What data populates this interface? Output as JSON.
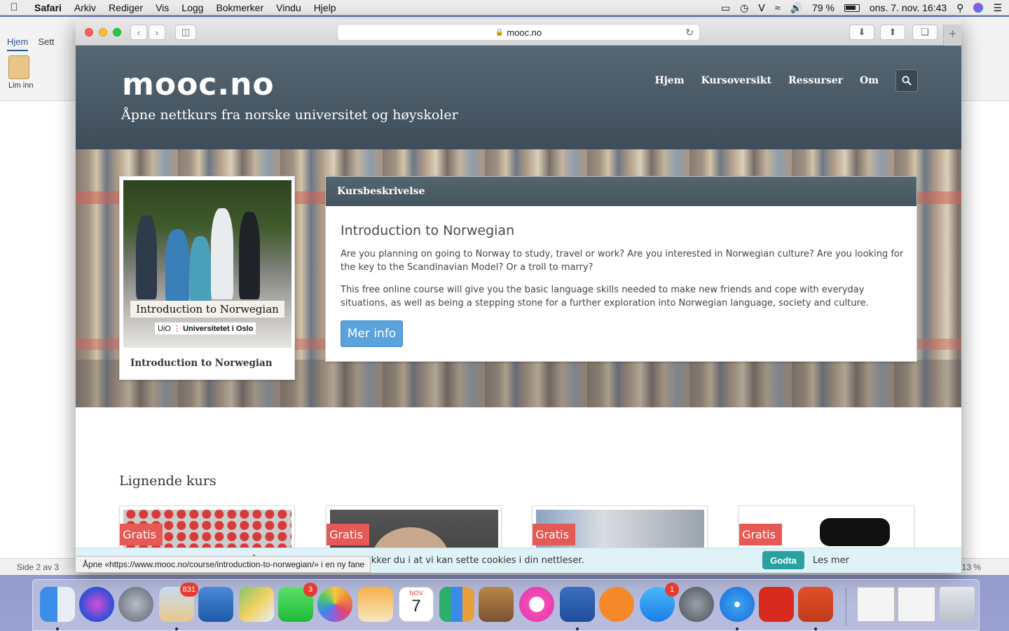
{
  "menubar": {
    "app": "Safari",
    "items": [
      "Arkiv",
      "Rediger",
      "Vis",
      "Logg",
      "Bokmerker",
      "Vindu",
      "Hjelp"
    ],
    "battery": "79 %",
    "datetime": "ons. 7. nov.  16:43"
  },
  "word": {
    "tab_home": "Hjem",
    "tab_settings": "Sett",
    "paste_label": "Lim inn",
    "page_status": "Side 2 av 3",
    "zoom": "13 %"
  },
  "safari": {
    "url": "mooc.no"
  },
  "site": {
    "logo": "mooc.no",
    "tagline": "Åpne nettkurs fra norske universitet og høyskoler",
    "nav": [
      "Hjem",
      "Kursoversikt",
      "Ressurser",
      "Om"
    ]
  },
  "course": {
    "image_caption": "Introduction to Norwegian",
    "image_uio": "UiO",
    "image_uio_name": "Universitetet i Oslo",
    "title": "Introduction to Norwegian"
  },
  "description": {
    "header": "Kursbeskrivelse",
    "title": "Introduction to Norwegian",
    "p1": "Are you planning on going to Norway to study, travel or work? Are you interested in Norwegian culture? Are you looking for the key to the Scandinavian Model? Or a troll to marry?",
    "p2": "This free online course will give you the basic language skills needed to make new friends and cope with everyday situations, as well as being a stepping stone for a further exploration into Norwegian language, society and culture.",
    "button": "Mer info"
  },
  "similar": {
    "title": "Lignende kurs",
    "badge": "Gratis"
  },
  "cookie": {
    "text": "kapsler). Ved å bruke nettsidene, samtykker du i at vi kan sette cookies i din nettleser.",
    "accept": "Godta",
    "more": "Les mer"
  },
  "status_link": "Åpne «https://www.mooc.no/course/introduction-to-norwegian/» i en ny fane",
  "dock": {
    "mail_badge": "831",
    "facetime_badge": "3",
    "appstore_badge": "1",
    "calendar_month": "NOV",
    "calendar_day": "7"
  }
}
